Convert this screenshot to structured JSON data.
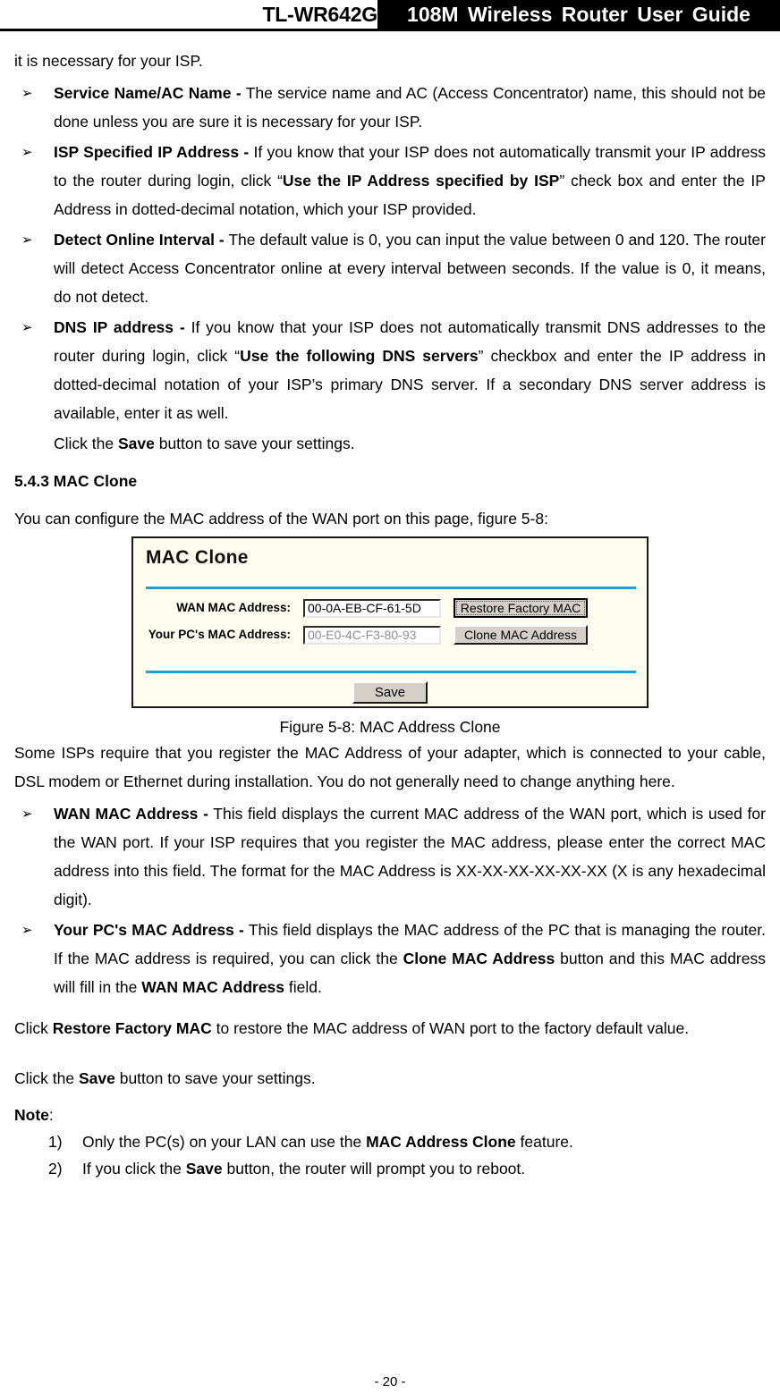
{
  "header": {
    "model": "TL-WR642G",
    "title": "108M Wireless Router User Guide"
  },
  "body": {
    "orphan_line": "it is necessary for your ISP.",
    "bullets_top": [
      {
        "marker": "➢",
        "term": "Service Name/AC Name -",
        "text": " The service name and AC (Access Concentrator) name, this should not be done unless you are sure it is necessary for your ISP."
      },
      {
        "marker": "➢",
        "term": "ISP Specified IP Address -",
        "text_1": " If you know that your ISP does not automatically transmit your IP address to the router during login, click “",
        "emph_1": "Use the IP Address specified by ISP",
        "text_2": "” check box and enter the IP Address in dotted-decimal notation, which your ISP provided."
      },
      {
        "marker": "➢",
        "term": "Detect Online Interval -",
        "text": " The default value is 0, you can input the value between 0 and 120. The router will detect Access Concentrator online at every interval between seconds. If the value is 0, it means, do not detect."
      },
      {
        "marker": "➢",
        "term": "DNS IP address -",
        "text_1": " If you know that your ISP does not automatically transmit DNS addresses to the router during login, click “",
        "emph_1": "Use the following DNS servers",
        "text_2": "” checkbox and enter the IP address in dotted-decimal notation of your ISP’s primary DNS server. If a secondary DNS server address is available, enter it as well."
      }
    ],
    "click_save_1": {
      "pre": "Click the ",
      "emph": "Save",
      "post": " button to save your settings."
    },
    "section_heading": "5.4.3 MAC Clone",
    "intro": "You can configure the MAC address of the WAN port on this page, figure 5-8:",
    "figure_caption": "Figure 5-8: MAC Address Clone",
    "para_some_isps": "Some ISPs require that you register the MAC Address of your adapter, which is connected to your cable, DSL modem or Ethernet during installation. You do not generally need to change anything here.",
    "bullets_bottom": [
      {
        "marker": "➢",
        "term": "WAN MAC Address -",
        "text": " This field displays the current MAC address of the WAN port, which is used for the WAN port. If your ISP requires that you register the MAC address, please enter the correct MAC address into this field. The format for the MAC Address is XX-XX-XX-XX-XX-XX (X is any hexadecimal digit)."
      },
      {
        "marker": "➢",
        "term": "Your PC's MAC Address -",
        "text_1": " This field displays the MAC address of the PC that is managing the router. If the MAC address is required, you can click the ",
        "emph_1": "Clone MAC Address",
        "text_2": " button and this MAC address will fill in the ",
        "emph_2": "WAN MAC Address",
        "text_3": " field."
      }
    ],
    "para_restore": {
      "pre": "Click ",
      "emph": "Restore Factory MAC",
      "post": " to restore the MAC address of WAN port to the factory default value."
    },
    "click_save_2": {
      "pre": "Click the ",
      "emph": "Save",
      "post": " button to save your settings."
    },
    "note": {
      "label": "Note",
      "colon": ":",
      "items": [
        {
          "num": "1)",
          "pre": "Only the PC(s) on your LAN can use the ",
          "emph": "MAC Address Clone",
          "post": " feature."
        },
        {
          "num": "2)",
          "pre": "If you click the ",
          "emph": "Save",
          "post": " button, the router will prompt you to reboot."
        }
      ]
    }
  },
  "router_ui": {
    "title": "MAC Clone",
    "fields": [
      {
        "label": "WAN MAC Address:",
        "value": "00-0A-EB-CF-61-5D",
        "disabled": false,
        "button": "Restore Factory MAC",
        "button_focused": true
      },
      {
        "label": "Your PC's MAC Address:",
        "value": "00-E0-4C-F3-80-93",
        "disabled": true,
        "button": "Clone MAC Address",
        "button_focused": false
      }
    ],
    "save_button": "Save",
    "colors": {
      "panel_background": "#fdfdf0",
      "divider": "#1e9fd8",
      "button_face": "#d4d0c8",
      "border": "#1a1a1a"
    }
  },
  "footer": {
    "page_number": "- 20 -"
  }
}
